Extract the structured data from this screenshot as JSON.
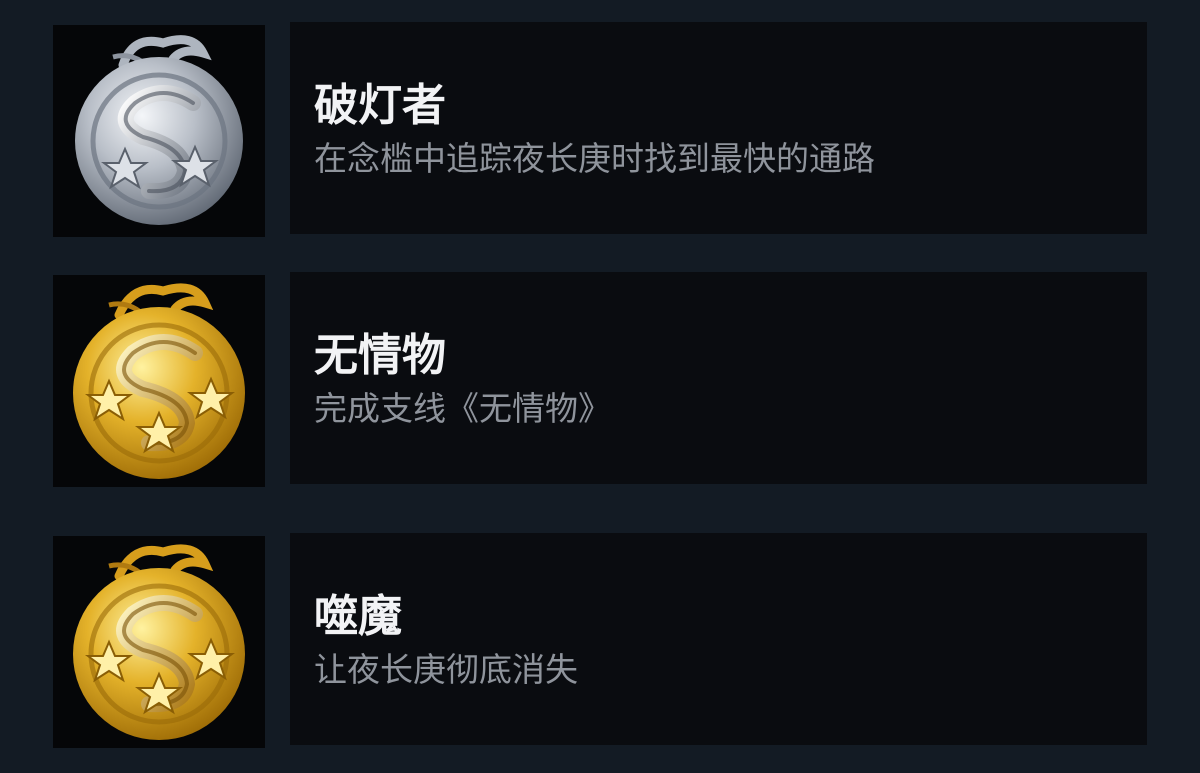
{
  "achievements": [
    {
      "title": "破灯者",
      "description": "在念槛中追踪夜长庚时找到最快的通路",
      "tier": "silver",
      "stars": 2,
      "icon": "dragon-medal-silver-icon"
    },
    {
      "title": "无情物",
      "description": "完成支线《无情物》",
      "tier": "gold",
      "stars": 3,
      "icon": "dragon-medal-gold-icon"
    },
    {
      "title": "噬魔",
      "description": "让夜长庚彻底消失",
      "tier": "gold",
      "stars": 3,
      "icon": "dragon-medal-gold-icon"
    }
  ],
  "colors": {
    "background": "#131b24",
    "card": "#0a0c10",
    "title": "#f2f3f5",
    "description": "#8f949c",
    "silver_light": "#e6e9ee",
    "silver_dark": "#5e6672",
    "gold_light": "#fff2a0",
    "gold_dark": "#9c6a05"
  }
}
